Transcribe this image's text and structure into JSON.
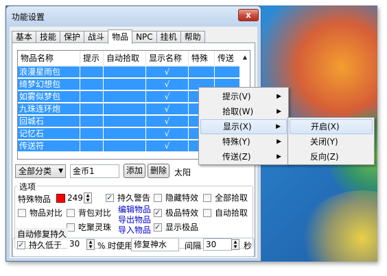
{
  "window": {
    "title": "功能设置",
    "close_label": "x"
  },
  "tabs": [
    {
      "label": "基本"
    },
    {
      "label": "技能"
    },
    {
      "label": "保护"
    },
    {
      "label": "战斗"
    },
    {
      "label": "物品"
    },
    {
      "label": "NPC"
    },
    {
      "label": "挂机"
    },
    {
      "label": "帮助"
    }
  ],
  "active_tab": "物品",
  "list": {
    "columns": [
      "物品名称",
      "提示",
      "自动拾取",
      "显示名称",
      "特殊",
      "传送"
    ],
    "rows": [
      {
        "name": "浪漫星雨包",
        "hint": "",
        "pickup": "",
        "show": "√",
        "special": "",
        "teleport": ""
      },
      {
        "name": "绮梦幻想包",
        "hint": "",
        "pickup": "",
        "show": "√",
        "special": "",
        "teleport": ""
      },
      {
        "name": "如雾似梦包",
        "hint": "",
        "pickup": "",
        "show": "√",
        "special": "",
        "teleport": ""
      },
      {
        "name": "九珠连环炮",
        "hint": "",
        "pickup": "",
        "show": "√",
        "special": "",
        "teleport": ""
      },
      {
        "name": "回城石",
        "hint": "",
        "pickup": "",
        "show": "√",
        "special": "",
        "teleport": ""
      },
      {
        "name": "记忆石",
        "hint": "",
        "pickup": "",
        "show": "√",
        "special": "",
        "teleport": ""
      },
      {
        "name": "传送符",
        "hint": "",
        "pickup": "",
        "show": "√",
        "special": "",
        "teleport": ""
      }
    ]
  },
  "toolbar": {
    "category": "全部分类",
    "item_input": "金币1",
    "add_label": "添加",
    "delete_label": "删除",
    "extra_text": "太阳"
  },
  "options": {
    "group_label": "选项",
    "special_item_label": "特殊物品",
    "special_value": "249",
    "colors": {
      "special": "#ff0000"
    },
    "durability_warning": "持久警告",
    "hide_effects": "隐藏特效",
    "pickup_all": "全部拾取",
    "item_compare": "物品对比",
    "bag_compare": "背包对比",
    "edit_items": "编辑物品",
    "best_effects": "极品特效",
    "auto_pickup": "自动拾取",
    "export_items": "导出物品",
    "import_items": "导入物品",
    "gather_beads": "吃聚灵珠",
    "show_best": "显示极品"
  },
  "repair": {
    "group_label": "自动修复持久",
    "below_label": "持久低于",
    "below_value": "30",
    "percent_label": "% 时使用",
    "item": "修复神水",
    "interval_label": "间隔",
    "interval_value": "30",
    "seconds": "秒"
  },
  "context_menu": {
    "items": [
      {
        "label": "提示(V)"
      },
      {
        "label": "拾取(W)"
      },
      {
        "label": "显示(X)"
      },
      {
        "label": "特殊(Y)"
      },
      {
        "label": "传送(Z)"
      }
    ],
    "submenu": [
      {
        "label": "开启(X)"
      },
      {
        "label": "关闭(Y)"
      },
      {
        "label": "反向(Z)"
      }
    ]
  }
}
